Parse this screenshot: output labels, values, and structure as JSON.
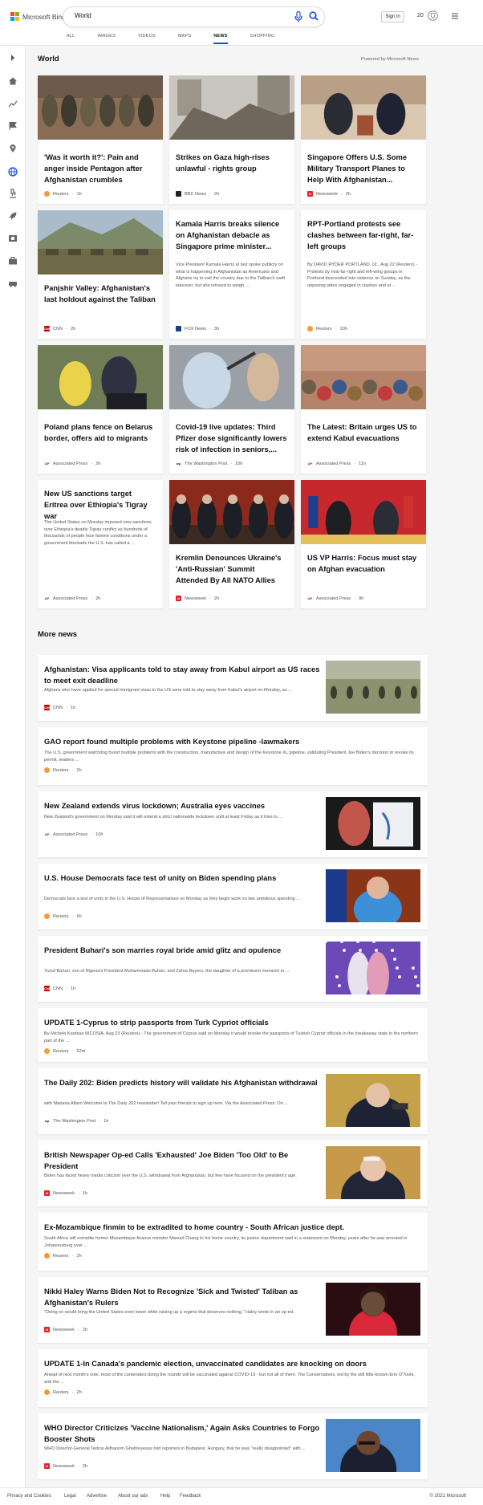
{
  "header": {
    "logo_text": "Microsoft Bing",
    "search_value": "World",
    "signin_label": "Sign in",
    "rewards_count": "20"
  },
  "tabs": [
    {
      "label": "ALL"
    },
    {
      "label": "IMAGES"
    },
    {
      "label": "VIDEOS"
    },
    {
      "label": "MAPS"
    },
    {
      "label": "NEWS"
    },
    {
      "label": "SHOPPING"
    }
  ],
  "sidebar_icons": [
    "chevron-right-icon",
    "home-icon",
    "trending-icon",
    "flag-icon",
    "map-pin-icon",
    "globe-icon",
    "microscope-icon",
    "rocket-icon",
    "film-icon",
    "briefcase-icon",
    "car-icon"
  ],
  "world": {
    "title": "World",
    "powered": "Powered by Microsoft News"
  },
  "cards": [
    {
      "title": "'Was it worth it?': Pain and anger inside Pentagon after Afghanistan crumbles",
      "snippet": "",
      "source": "Reuters",
      "time": "1h",
      "logo": "reuters"
    },
    {
      "title": "Strikes on Gaza high-rises unlawful - rights group",
      "snippet": "",
      "source": "BBC News",
      "time": "2h",
      "logo": "bbc"
    },
    {
      "title": "Singapore Offers U.S. Some Military Transport Planes to Help With Afghanistan...",
      "snippet": "",
      "source": "Newsweek",
      "time": "2h",
      "logo": "newsweek"
    },
    {
      "title": "Panjshir Valley: Afghanistan's last holdout against the Taliban",
      "snippet": "",
      "source": "CNN",
      "time": "2h",
      "logo": "cnn"
    },
    {
      "title": "Kamala Harris breaks silence on Afghanistan debacle as Singapore prime minister...",
      "snippet": "Vice President Kamala Harris at last spoke publicly on what is happening in Afghanistan as Americans and Afghans try to exit the country due to the Taliban's swift takeover, but she refused to weigh ...",
      "source": "FOX News",
      "time": "3h",
      "logo": "fox"
    },
    {
      "title": "RPT-Portland protests see clashes between far-right, far-left groups",
      "snippet": "By DAVID RYDER PORTLAND, Or., Aug 22 (Reuters) - Protests by rival far-right and left-wing groups in Portland descended into violence on Sunday, as the opposing sides engaged in clashes and at ...",
      "source": "Reuters",
      "time": "10h",
      "logo": "reuters"
    },
    {
      "title": "Poland plans fence on Belarus border, offers aid to migrants",
      "snippet": "",
      "source": "Associated Press",
      "time": "2h",
      "logo": "ap"
    },
    {
      "title": "Covid-19 live updates: Third Pfizer dose significantly lowers risk of infection in seniors,...",
      "snippet": "",
      "source": "The Washington Post",
      "time": "10h",
      "logo": "wp"
    },
    {
      "title": "The Latest: Britain urges US to extend Kabul evacuations",
      "snippet": "",
      "source": "Associated Press",
      "time": "11h",
      "logo": "ap"
    },
    {
      "title": "New US sanctions target Eritrea over Ethiopia's Tigray war",
      "snippet": "The United States on Monday imposed new sanctions over Ethiopia's deadly Tigray conflict as hundreds of thousands of people face famine conditions under a government blockade the U.S. has called a ...",
      "source": "Associated Press",
      "time": "2h",
      "logo": "ap"
    },
    {
      "title": "Kremlin Denounces Ukraine's 'Anti-Russian' Summit Attended By All NATO Allies",
      "snippet": "",
      "source": "Newsweek",
      "time": "2h",
      "logo": "newsweek"
    },
    {
      "title": "US VP Harris: Focus must stay on Afghan evacuation",
      "snippet": "",
      "source": "Associated Press",
      "time": "9h",
      "logo": "ap"
    }
  ],
  "more": {
    "title": "More news"
  },
  "items": [
    {
      "title": "Afghanistan: Visa applicants told to stay away from Kabul airport as US races to meet exit deadline",
      "snippet": "Afghans who have applied for special immigrant visas to the US were told to stay away from Kabul's airport on Monday, as ...",
      "source": "CNN",
      "time": "1h",
      "logo": "cnn",
      "img": "field"
    },
    {
      "title": "GAO report found multiple problems with Keystone pipeline -lawmakers",
      "snippet": "The U.S. government watchdog found multiple problems with the construction, manufacture and design of the Keystone XL pipeline, validating President Joe Biden's decision to revoke its permit, leaders ...",
      "source": "Reuters",
      "time": "2h",
      "logo": "reuters",
      "img": ""
    },
    {
      "title": "New Zealand extends virus lockdown; Australia eyes vaccines",
      "snippet": "New Zealand's government on Monday said it will extend a strict nationwide lockdown until at least Friday as it tries to ...",
      "source": "Associated Press",
      "time": "10h",
      "logo": "ap",
      "img": "nz"
    },
    {
      "title": "U.S. House Democrats face test of unity on Biden spending plans",
      "snippet": "Democrats face a test of unity in the U.S. House of Representatives on Monday as they begin work on two ambitious spending ...",
      "source": "Reuters",
      "time": "6h",
      "logo": "reuters",
      "img": "pelosi"
    },
    {
      "title": "President Buhari's son marries royal bride amid glitz and opulence",
      "snippet": "Yusuf Buhari, son of Nigeria's President Muhammadu Buhari, and Zahra Bayero, the daughter of a prominent monarch in ...",
      "source": "CNN",
      "time": "1h",
      "logo": "cnn",
      "img": "wedding"
    },
    {
      "title": "UPDATE 1-Cyprus to strip passports from Turk Cypriot officials",
      "snippet": "By Michele Kambas NICOSIA, Aug 23 (Reuters) - The government of Cyprus said on Monday it would revoke the passports of Turkish Cypriot officials in the breakaway state in the northern part of the ...",
      "source": "Reuters",
      "time": "52m",
      "logo": "reuters",
      "img": ""
    },
    {
      "title": "The Daily 202: Biden predicts history will validate his Afghanistan withdrawal",
      "snippet": "with Mariana Alfaro Welcome to The Daily 202 newsletter! Tell your friends to sign up here. Via the Associated Press: On ...",
      "source": "The Washington Post",
      "time": "1h",
      "logo": "wp",
      "img": "biden1"
    },
    {
      "title": "British Newspaper Op-ed Calls 'Exhausted' Joe Biden 'Too Old' to Be President",
      "snippet": "Biden has faced heavy media criticism over the U.S. withdrawal from Afghanistan, but few have focused on the president's age.",
      "source": "Newsweek",
      "time": "1h",
      "logo": "newsweek",
      "img": "biden2"
    },
    {
      "title": "Ex-Mozambique finmin to be extradited to home country - South African justice dept.",
      "snippet": "South Africa will extradite former Mozambique finance minister Manuel Chang to his home country, its justice department said in a statement on Monday, years after he was arrested in Johannesburg over ...",
      "source": "Reuters",
      "time": "2h",
      "logo": "reuters",
      "img": ""
    },
    {
      "title": "Nikki Haley Warns Biden Not to Recognize 'Sick and Twisted' Taliban as Afghanistan's Rulers",
      "snippet": "\"Doing so would bring the United States even lower while raising up a regime that deserves nothing,\" Haley wrote in an op-ed.",
      "source": "Newsweek",
      "time": "2h",
      "logo": "newsweek",
      "img": "haley"
    },
    {
      "title": "UPDATE 1-In Canada's pandemic election, unvaccinated candidates are knocking on doors",
      "snippet": "Ahead of next month's vote, most of the contenders doing the rounds will be vaccinated against COVID-19 - but not all of them. The Conservatives, led by the still little-known Erin O'Toole, and the ...",
      "source": "Reuters",
      "time": "2h",
      "logo": "reuters",
      "img": ""
    },
    {
      "title": "WHO Director Criticizes 'Vaccine Nationalism,' Again Asks Countries to Forgo Booster Shots",
      "snippet": "WHO Director-General Tedros Adhanom Ghebreyesus told reporters in Budapest, Hungary, that he was \"really disappointed\" with ...",
      "source": "Newsweek",
      "time": "2h",
      "logo": "newsweek",
      "img": "tedros"
    }
  ],
  "footer": {
    "links": [
      "Privacy and Cookies",
      "Legal",
      "Advertise",
      "About our ads",
      "Help",
      "Feedback"
    ],
    "copyright": "© 2021 Microsoft"
  }
}
